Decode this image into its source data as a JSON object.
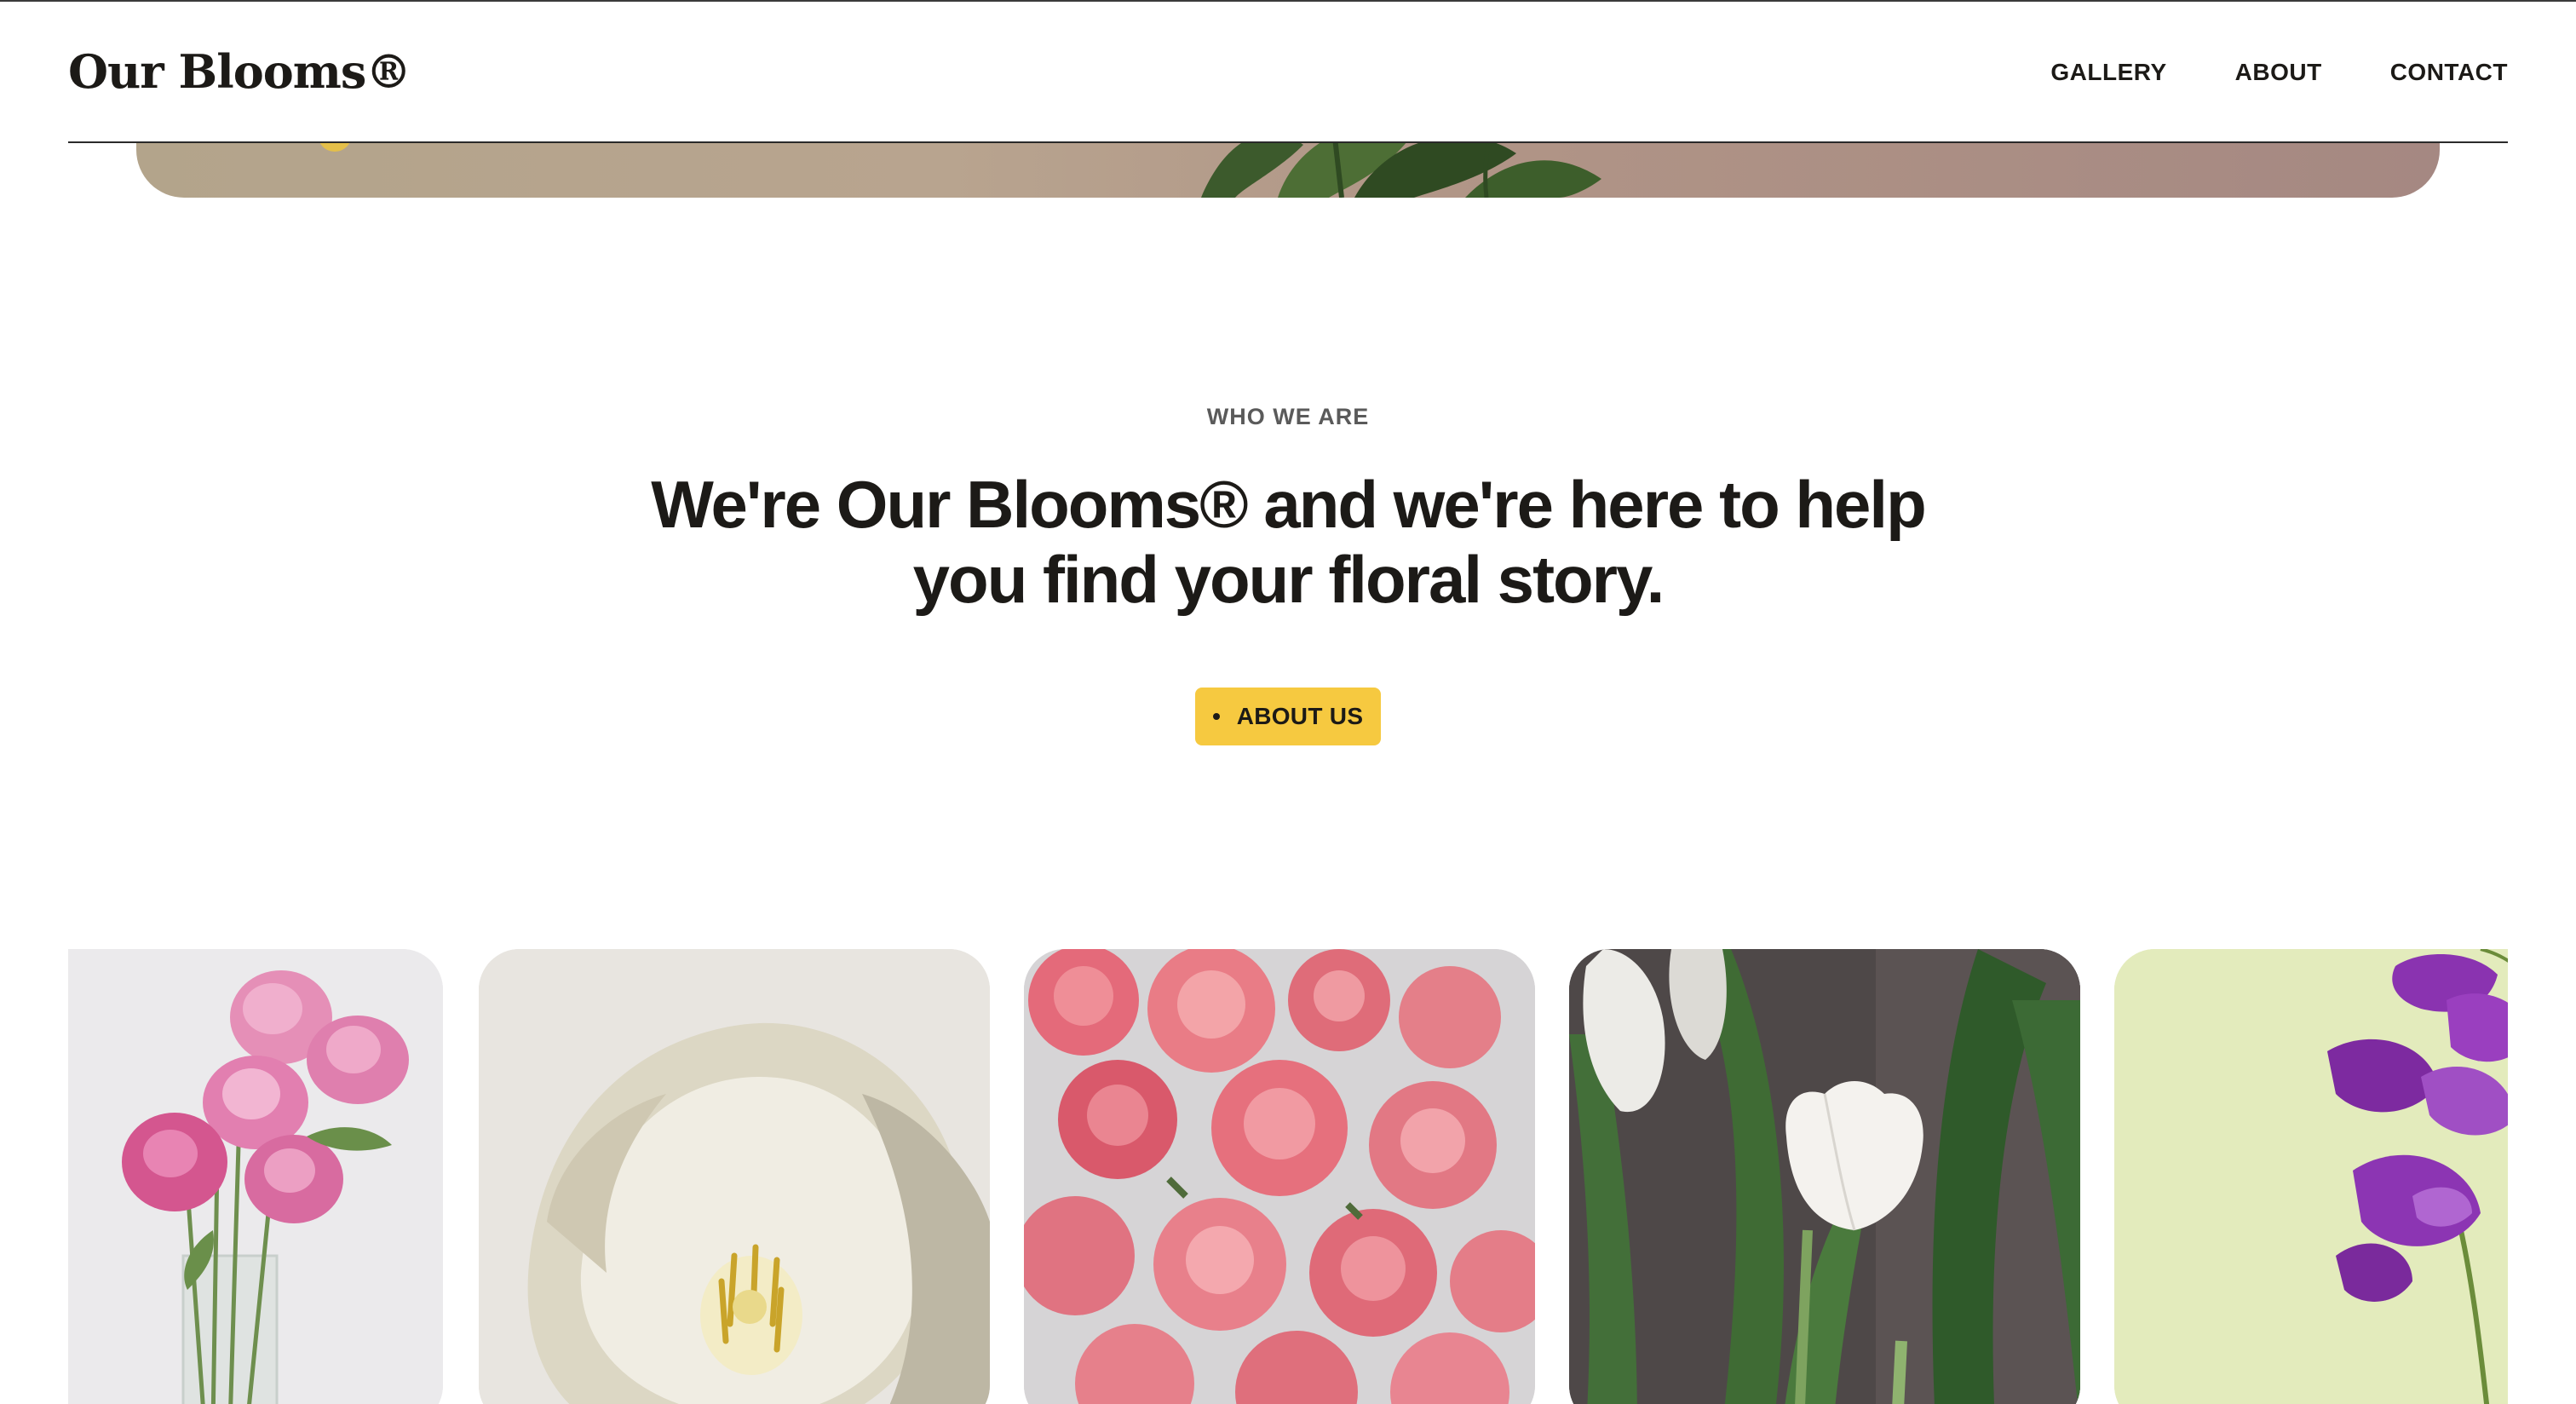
{
  "header": {
    "logo": "Our Blooms®",
    "nav": [
      {
        "label": "GALLERY"
      },
      {
        "label": "ABOUT"
      },
      {
        "label": "CONTACT"
      }
    ]
  },
  "about_section": {
    "eyebrow": "WHO WE ARE",
    "headline_line1": "We're Our Blooms® and we're here to help",
    "headline_line2": "you find your floral story.",
    "cta_label": "ABOUT US"
  },
  "gallery": {
    "items": [
      {
        "subject": "pink peonies in glass vase"
      },
      {
        "subject": "open white tulip"
      },
      {
        "subject": "pink roses bouquet"
      },
      {
        "subject": "white tulips with leaves"
      },
      {
        "subject": "purple sweet peas"
      }
    ]
  },
  "colors": {
    "accent": "#f6c940",
    "text": "#1c1a17",
    "muted": "#5a5a5a",
    "background": "#ffffff"
  }
}
